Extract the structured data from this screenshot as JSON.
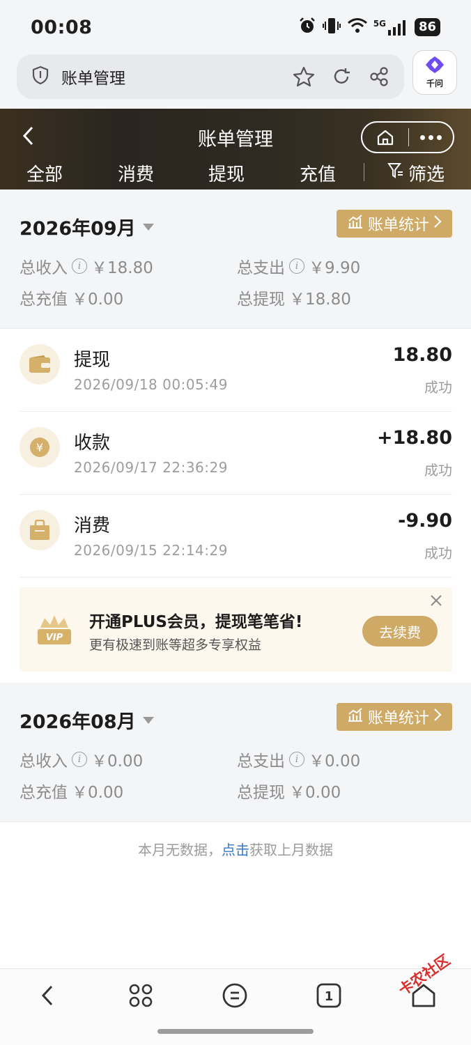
{
  "status_bar": {
    "time": "00:08",
    "network": "5G",
    "battery": "86"
  },
  "browser": {
    "title": "账单管理"
  },
  "qianwen": {
    "label": "千问"
  },
  "header": {
    "title": "账单管理"
  },
  "tabs": [
    {
      "label": "全部"
    },
    {
      "label": "消费"
    },
    {
      "label": "提现"
    },
    {
      "label": "充值"
    }
  ],
  "filter_label": "筛选",
  "months": [
    {
      "title": "2026年09月",
      "stats_button": "账单统计",
      "total_income_label": "总收入",
      "total_income": "￥18.80",
      "total_expense_label": "总支出",
      "total_expense": "￥9.90",
      "total_recharge_label": "总充值",
      "total_recharge": "￥0.00",
      "total_withdraw_label": "总提现",
      "total_withdraw": "￥18.80"
    },
    {
      "title": "2026年08月",
      "stats_button": "账单统计",
      "total_income_label": "总收入",
      "total_income": "￥0.00",
      "total_expense_label": "总支出",
      "total_expense": "￥0.00",
      "total_recharge_label": "总充值",
      "total_recharge": "￥0.00",
      "total_withdraw_label": "总提现",
      "total_withdraw": "￥0.00"
    }
  ],
  "transactions": [
    {
      "name": "提现",
      "time": "2026/09/18 00:05:49",
      "amount": "18.80",
      "status": "成功",
      "icon": "wallet-icon"
    },
    {
      "name": "收款",
      "time": "2026/09/17 22:36:29",
      "amount": "+18.80",
      "status": "成功",
      "icon": "yuan-coin-icon"
    },
    {
      "name": "消费",
      "time": "2026/09/15 22:14:29",
      "amount": "-9.90",
      "status": "成功",
      "icon": "shopping-bag-icon"
    }
  ],
  "promo": {
    "title": "开通PLUS会员，提现笔笔省!",
    "subtitle": "更有极速到账等超多专享权益",
    "button": "去续费",
    "badge": "VIP"
  },
  "no_data": {
    "prefix": "本月无数据，",
    "link": "点击",
    "suffix": "获取上月数据"
  },
  "watermark": "卡农社区",
  "colors": {
    "gold": "#cfaa66",
    "header_dark": "#2a261f",
    "link": "#3979c9"
  }
}
